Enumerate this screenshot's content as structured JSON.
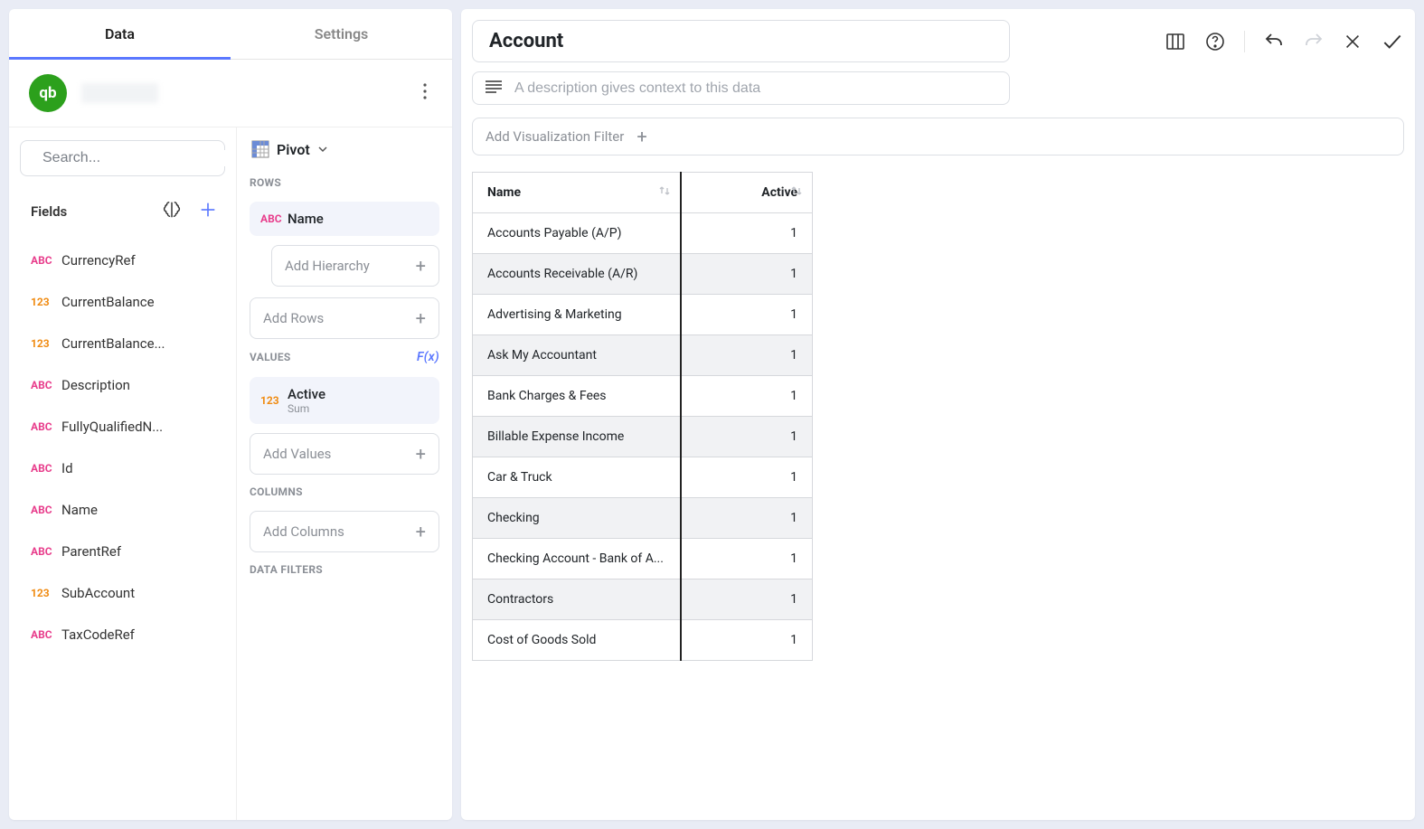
{
  "tabs": {
    "data": "Data",
    "settings": "Settings"
  },
  "search": {
    "placeholder": "Search..."
  },
  "fieldsHeader": "Fields",
  "fields": [
    {
      "type": "ABC",
      "name": "CurrencyRef"
    },
    {
      "type": "123",
      "name": "CurrentBalance"
    },
    {
      "type": "123",
      "name": "CurrentBalance..."
    },
    {
      "type": "ABC",
      "name": "Description"
    },
    {
      "type": "ABC",
      "name": "FullyQualifiedN..."
    },
    {
      "type": "ABC",
      "name": "Id"
    },
    {
      "type": "ABC",
      "name": "Name"
    },
    {
      "type": "ABC",
      "name": "ParentRef"
    },
    {
      "type": "123",
      "name": "SubAccount"
    },
    {
      "type": "ABC",
      "name": "TaxCodeRef"
    }
  ],
  "viz": {
    "label": "Pivot"
  },
  "sections": {
    "rows": "ROWS",
    "values": "VALUES",
    "columns": "COLUMNS",
    "filters": "DATA FILTERS",
    "fx": "F(x)"
  },
  "rowPills": [
    {
      "type": "ABC",
      "label": "Name"
    }
  ],
  "valuePills": [
    {
      "type": "123",
      "label": "Active",
      "sub": "Sum"
    }
  ],
  "dropzones": {
    "hierarchy": "Add Hierarchy",
    "rows": "Add Rows",
    "values": "Add Values",
    "columns": "Add Columns"
  },
  "title": "Account",
  "description": {
    "placeholder": "A description gives context to this data"
  },
  "filterBtn": "Add Visualization Filter",
  "tableHeaders": {
    "name": "Name",
    "active": "Active"
  },
  "tableRows": [
    {
      "name": "Accounts Payable (A/P)",
      "active": "1"
    },
    {
      "name": "Accounts Receivable (A/R)",
      "active": "1"
    },
    {
      "name": "Advertising & Marketing",
      "active": "1"
    },
    {
      "name": "Ask My Accountant",
      "active": "1"
    },
    {
      "name": "Bank Charges & Fees",
      "active": "1"
    },
    {
      "name": "Billable Expense Income",
      "active": "1"
    },
    {
      "name": "Car & Truck",
      "active": "1"
    },
    {
      "name": "Checking",
      "active": "1"
    },
    {
      "name": "Checking Account - Bank of A...",
      "active": "1"
    },
    {
      "name": "Contractors",
      "active": "1"
    },
    {
      "name": "Cost of Goods Sold",
      "active": "1"
    }
  ]
}
